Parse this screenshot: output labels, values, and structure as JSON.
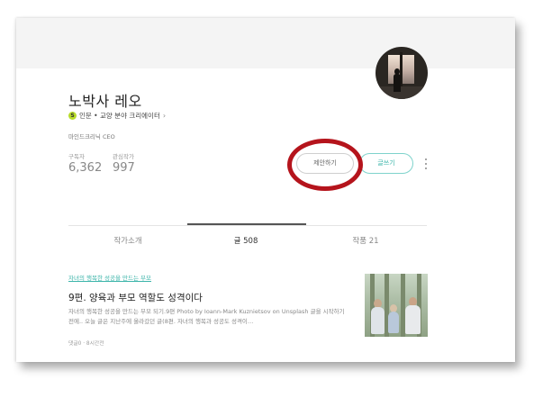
{
  "profile": {
    "name": "노박사 레오",
    "badge_letter": "S",
    "creator_label": "인문 • 교양 분야 크리에이터",
    "creator_chevron": "›",
    "bio": "마인드크리닉 CEO",
    "subscribers_label": "구독자",
    "subscribers_count": "6,362",
    "following_label": "관심작가",
    "following_count": "997"
  },
  "actions": {
    "propose_label": "제안하기",
    "write_label": "글쓰기"
  },
  "tabs": [
    {
      "label": "작가소개"
    },
    {
      "label": "글 508"
    },
    {
      "label": "작품 21"
    }
  ],
  "article": {
    "magazine": "자녀의 행복한 성공을 만드는 부모",
    "title": "9편. 양육과 부모 역할도 성격이다",
    "excerpt": "자녀의 행복한 성공을 만드는 부모 되기.9편   Photo by Ioann-Mark Kuznietsov on Unsplash 글을 시작하기 전에.. 오늘 글은 지난주에 올라갔던 글(8편. 자녀의 행복과 성공도 성격이…",
    "comments": "댓글0",
    "time": "8시간전"
  },
  "colors": {
    "accent": "#3cb5aa",
    "highlight": "#b5141c",
    "badge": "#b7dc2a"
  }
}
